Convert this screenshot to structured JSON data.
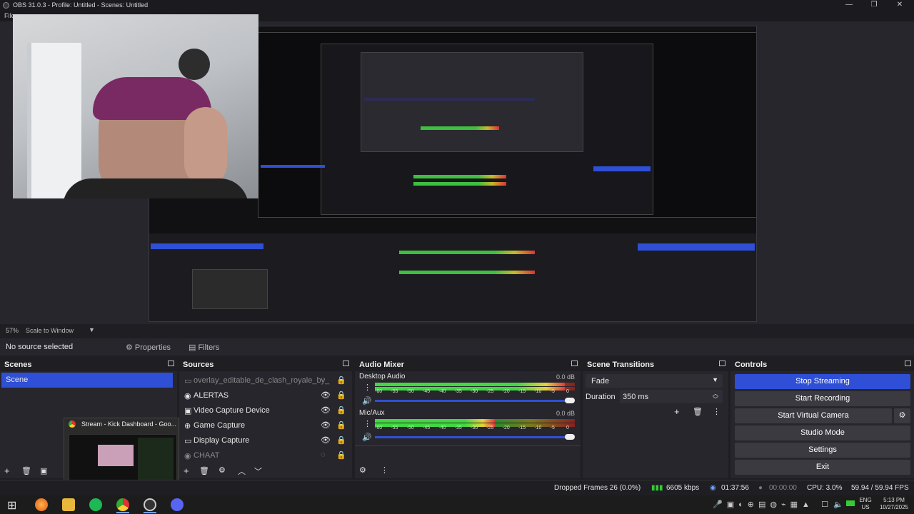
{
  "window": {
    "title": "OBS 31.0.3 - Profile: Untitled - Scenes: Untitled",
    "menu_first": "File"
  },
  "preview": {
    "scale_percent": "57%",
    "scale_mode": "Scale to Window"
  },
  "source_toolbar": {
    "status": "No source selected",
    "properties": "Properties",
    "filters": "Filters"
  },
  "scenes": {
    "title": "Scenes",
    "items": [
      "Scene"
    ]
  },
  "sources": {
    "title": "Sources",
    "items": [
      {
        "label": "overlay_editable_de_clash_royale_by_",
        "visible": false
      },
      {
        "label": "ALERTAS",
        "visible": true
      },
      {
        "label": "Video Capture Device",
        "visible": true
      },
      {
        "label": "Game Capture",
        "visible": true
      },
      {
        "label": "Display Capture",
        "visible": true
      },
      {
        "label": "CHAAT",
        "visible": false
      }
    ]
  },
  "mixer": {
    "title": "Audio Mixer",
    "channels": [
      {
        "name": "Desktop Audio",
        "db": "0.0 dB",
        "level": 0.95
      },
      {
        "name": "Mic/Aux",
        "db": "0.0 dB",
        "level": 0.6
      }
    ],
    "ticks": [
      "-60",
      "-55",
      "-50",
      "-45",
      "-40",
      "-35",
      "-30",
      "-25",
      "-20",
      "-15",
      "-10",
      "-5",
      "0"
    ]
  },
  "transitions": {
    "title": "Scene Transitions",
    "selected": "Fade",
    "duration_label": "Duration",
    "duration_value": "350 ms"
  },
  "controls": {
    "title": "Controls",
    "buttons": [
      "Stop Streaming",
      "Start Recording",
      "Start Virtual Camera",
      "Studio Mode",
      "Settings",
      "Exit"
    ]
  },
  "popup": {
    "title": "Stream - Kick Dashboard - Goo..."
  },
  "status": {
    "dropped": "Dropped Frames 26 (0.0%)",
    "bitrate": "6605 kbps",
    "stream_time": "01:37:56",
    "rec_time": "00:00:00",
    "cpu": "CPU: 3.0%",
    "fps": "59.94 / 59.94 FPS"
  },
  "taskbar": {
    "lang_top": "ENG",
    "lang_bottom": "US",
    "time": "5:13 PM",
    "date": "10/27/2025"
  },
  "colors": {
    "accent": "#2f4fd6",
    "panel": "#26262c",
    "bg": "#1e1e23"
  }
}
